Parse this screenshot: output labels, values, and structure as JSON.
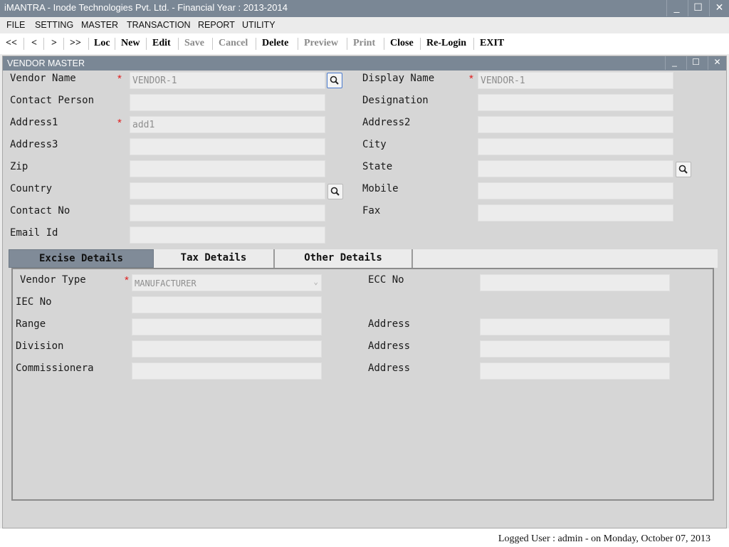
{
  "app": {
    "title": "iMANTRA - Inode Technologies Pvt. Ltd. - Financial Year : 2013-2014",
    "window_buttons": {
      "minimize": "_",
      "maximize": "☐",
      "close": "✕"
    }
  },
  "menu": [
    "FILE",
    "SETTING",
    "MASTER",
    "TRANSACTION",
    "REPORT",
    "UTILITY"
  ],
  "toolbar": {
    "first": "<<",
    "prev": "<",
    "next": ">",
    "last": ">>",
    "loc": "Loc",
    "new": "New",
    "edit": "Edit",
    "save": "Save",
    "cancel": "Cancel",
    "delete": "Delete",
    "preview": "Preview",
    "print": "Print",
    "close": "Close",
    "relogin": "Re-Login",
    "exit": "EXIT"
  },
  "vendor_master": {
    "title": "VENDOR MASTER",
    "window_buttons": {
      "minimize": "_",
      "maximize": "☐",
      "close": "✕"
    },
    "required_mark": "*",
    "fields": {
      "vendor_name": {
        "label": "Vendor Name",
        "value": "VENDOR-1"
      },
      "display_name": {
        "label": "Display Name",
        "value": "VENDOR-1"
      },
      "contact_person": {
        "label": "Contact Person",
        "value": ""
      },
      "designation": {
        "label": "Designation",
        "value": ""
      },
      "address1": {
        "label": "Address1",
        "value": "add1"
      },
      "address2": {
        "label": "Address2",
        "value": ""
      },
      "address3": {
        "label": "Address3",
        "value": ""
      },
      "city": {
        "label": "City",
        "value": ""
      },
      "zip": {
        "label": "Zip",
        "value": ""
      },
      "state": {
        "label": "State",
        "value": ""
      },
      "country": {
        "label": "Country",
        "value": ""
      },
      "mobile": {
        "label": "Mobile",
        "value": ""
      },
      "contact_no": {
        "label": "Contact No",
        "value": ""
      },
      "fax": {
        "label": "Fax",
        "value": ""
      },
      "email_id": {
        "label": "Email Id",
        "value": ""
      }
    }
  },
  "tabs": [
    {
      "label": "Excise Details",
      "active": true
    },
    {
      "label": "Tax Details",
      "active": false
    },
    {
      "label": "Other Details",
      "active": false
    }
  ],
  "excise": {
    "vendor_type": {
      "label": "Vendor Type",
      "value": "MANUFACTURER"
    },
    "ecc_no": {
      "label": "ECC No",
      "value": ""
    },
    "iec_no": {
      "label": "IEC No",
      "value": ""
    },
    "range": {
      "label": "Range",
      "value": ""
    },
    "range_address": {
      "label": "Address",
      "value": ""
    },
    "division": {
      "label": "Division",
      "value": ""
    },
    "division_address": {
      "label": "Address",
      "value": ""
    },
    "commissionera": {
      "label": "Commissionera",
      "value": ""
    },
    "commissionera_address": {
      "label": "Address",
      "value": ""
    }
  },
  "status": {
    "text": "Logged User : admin - on Monday, October 07, 2013"
  },
  "colors": {
    "titlebar": "#7a8795",
    "required": "#e02020",
    "active_tab": "#808b98"
  },
  "icons": {
    "search": "search-icon",
    "dropdown": "chevron-down-icon"
  }
}
